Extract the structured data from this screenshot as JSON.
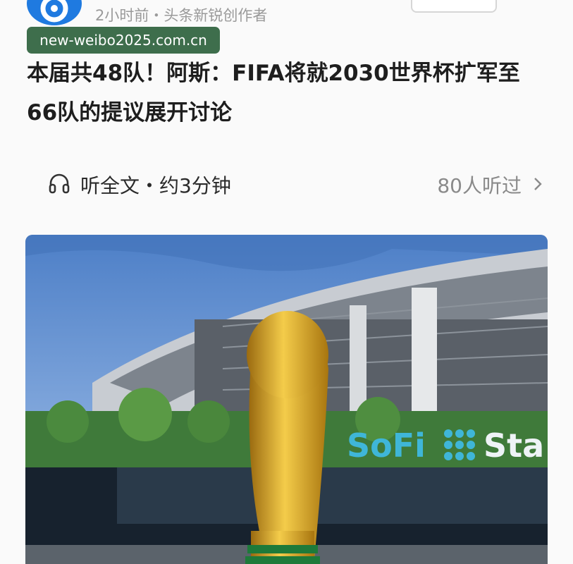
{
  "header": {
    "meta": "2小时前・头条新锐创作者",
    "watermark": "new-weibo2025.com.cn"
  },
  "article": {
    "title": "本届共48队！阿斯：FIFA将就2030世界杯扩军至66队的提议展开讨论",
    "listen_label": "听全文・约3分钟",
    "listen_count": "80人听过",
    "image": {
      "sign_text": "SoFi Sta",
      "icons": [
        "headphone-icon",
        "chevron-right-icon"
      ],
      "colors": {
        "sky": "#6f9fdc",
        "trophy": "#d9a520",
        "sign": "#3fb6d8"
      }
    }
  }
}
